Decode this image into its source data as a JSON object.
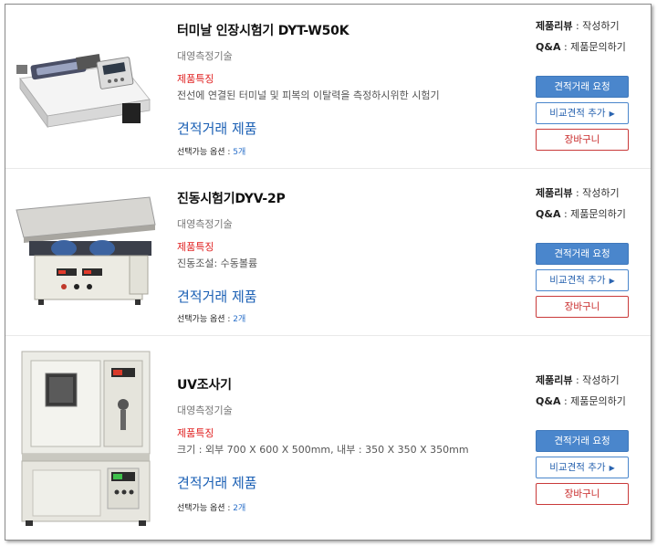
{
  "products": [
    {
      "name": "터미날 인장시험기 DYT-W50K",
      "maker": "대영측정기술",
      "feature_title": "제품특징",
      "feature_text": "전선에 연결된 터미널 및 피복의 이탈력을 측정하시위한 시험기",
      "quote_link": "견적거래 제품",
      "options_label": "선택가능 옵션 : ",
      "options_count": "5개",
      "review_label": "제품리뷰",
      "review_action": " : 작성하기",
      "qa_label": "Q&A",
      "qa_action": " : 제품문의하기",
      "btn_quote": "견적거래 요청",
      "btn_compare": "비교견적 추가",
      "btn_cart": "장바구니",
      "thumb_icon": "tensile-tester-image"
    },
    {
      "name": "진동시험기DYV-2P",
      "maker": "대영측정기술",
      "feature_title": "제품특징",
      "feature_text": "진동조설: 수동볼륨",
      "quote_link": "견적거래 제품",
      "options_label": "선택가능 옵션 : ",
      "options_count": "2개",
      "review_label": "제품리뷰",
      "review_action": " : 작성하기",
      "qa_label": "Q&A",
      "qa_action": " : 제품문의하기",
      "btn_quote": "견적거래 요청",
      "btn_compare": "비교견적 추가",
      "btn_cart": "장바구니",
      "thumb_icon": "vibration-tester-image"
    },
    {
      "name": "UV조사기",
      "maker": "대영측정기술",
      "feature_title": "제품특징",
      "feature_text": "크기 : 외부 700 X 600 X 500mm, 내부 : 350 X 350 X 350mm",
      "quote_link": "견적거래 제품",
      "options_label": "선택가능 옵션 : ",
      "options_count": "2개",
      "review_label": "제품리뷰",
      "review_action": " : 작성하기",
      "qa_label": "Q&A",
      "qa_action": " : 제품문의하기",
      "btn_quote": "견적거래 요청",
      "btn_compare": "비교견적 추가",
      "btn_cart": "장바구니",
      "thumb_icon": "uv-chamber-image"
    }
  ],
  "colors": {
    "link_blue": "#1a5fb4",
    "button_blue": "#4a86cc",
    "feature_red": "#e02020",
    "cart_red": "#c93a3a"
  }
}
